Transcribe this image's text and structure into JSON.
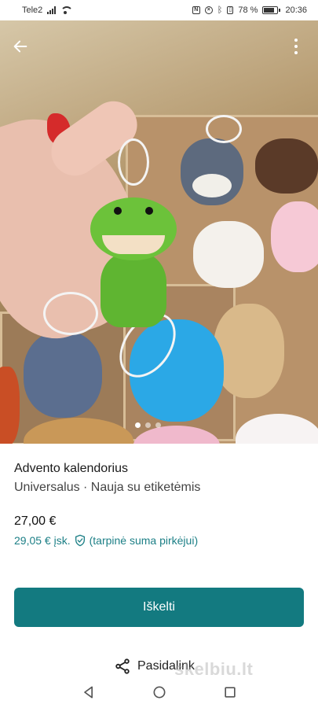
{
  "status_bar": {
    "carrier": "Tele2",
    "battery": "78 %",
    "time": "20:36"
  },
  "listing": {
    "title": "Advento kalendorius",
    "subtitle": "Universalus · Nauja su etiketėmis",
    "price": "27,00 €",
    "price_total": "29,05 € įsk.",
    "price_note": "(tarpinė suma pirkėjui)",
    "photo_count_dots": 3,
    "active_photo": 1
  },
  "actions": {
    "bump_label": "Iškelti",
    "share_label": "Pasidalink"
  },
  "watermark": "skelbiu.lt",
  "colors": {
    "accent": "#137a80",
    "accent_text": "#1c7f86"
  }
}
